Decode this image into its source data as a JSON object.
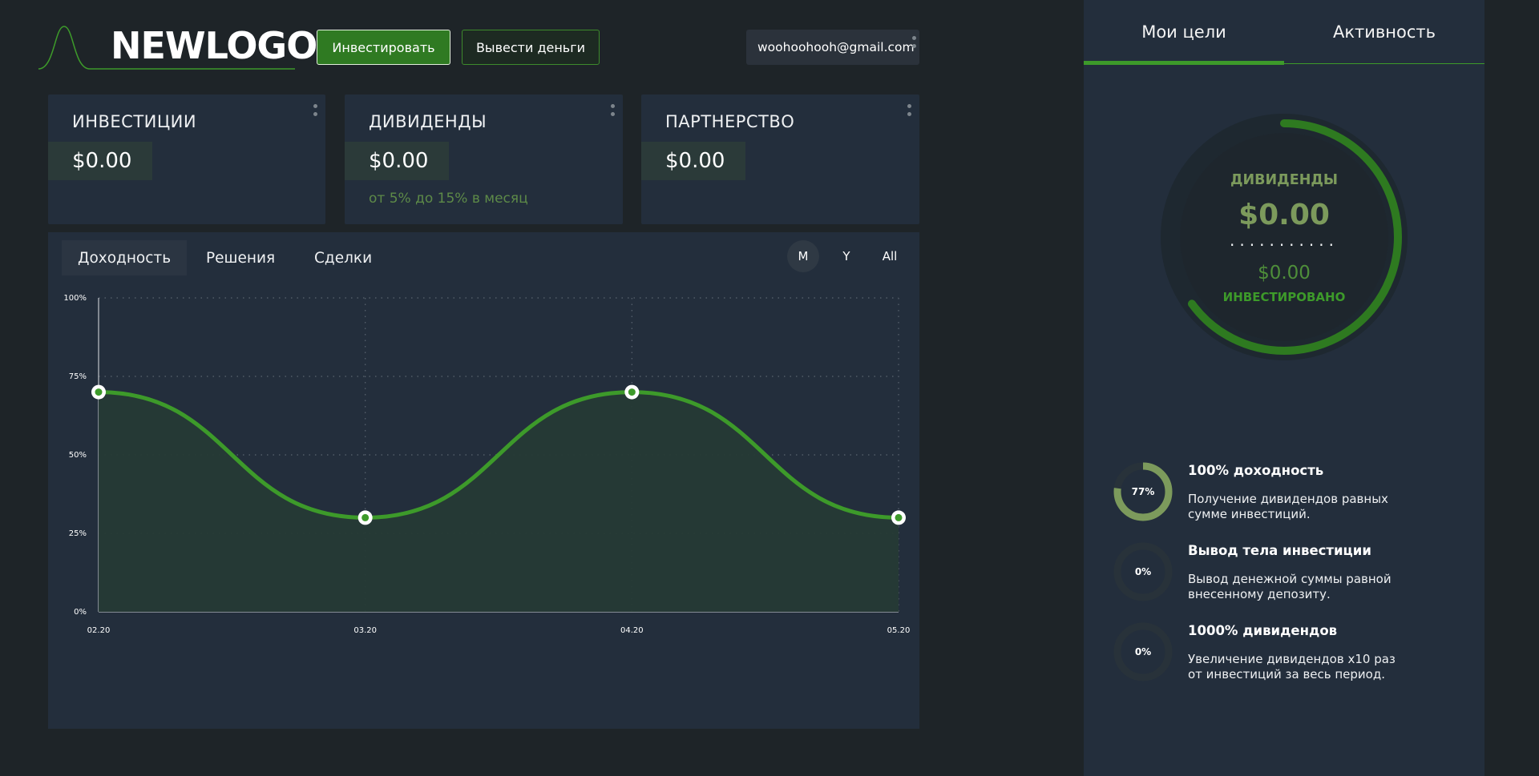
{
  "header": {
    "logo_text": "NEWLOGO",
    "invest_button": "Инвестировать",
    "withdraw_button": "Вывести деньги",
    "user_email": "woohoohooh@gmail.com"
  },
  "cards": [
    {
      "title": "ИНВЕСТИЦИИ",
      "value": "$0.00",
      "subtitle": ""
    },
    {
      "title": "ДИВИДЕНДЫ",
      "value": "$0.00",
      "subtitle": "от 5% до 15% в месяц"
    },
    {
      "title": "ПАРТНЕРСТВО",
      "value": "$0.00",
      "subtitle": ""
    }
  ],
  "chart_tabs": [
    "Доходность",
    "Решения",
    "Сделки"
  ],
  "range_buttons": [
    "M",
    "Y",
    "All"
  ],
  "chart_data": {
    "type": "area",
    "x": [
      "02.20",
      "03.20",
      "04.20",
      "05.20"
    ],
    "y_ticks": [
      "0%",
      "25%",
      "50%",
      "75%",
      "100%"
    ],
    "ylim": [
      0,
      100
    ],
    "series": [
      {
        "values": [
          70,
          30,
          70,
          30
        ]
      }
    ],
    "grid": true
  },
  "right_panel": {
    "tabs": [
      "Мои цели",
      "Активность"
    ],
    "ring_label": "ДИВИДЕНДЫ",
    "ring_value": "$0.00",
    "ring_dots": "...........",
    "ring_invested_value": "$0.00",
    "ring_invested_label": "ИНВЕСТИРОВАНО",
    "ring_progress": 0.65,
    "goals": [
      {
        "title": "100% доходность",
        "desc": "Получение дивидендов равных сумме инвестиций.",
        "pct_label": "77%",
        "pct": 77
      },
      {
        "title": "Вывод тела инвестиции",
        "desc": "Вывод денежной суммы равной внесенному депозиту.",
        "pct_label": "0%",
        "pct": 0
      },
      {
        "title": "1000% дивидендов",
        "desc": "Увеличение дивидендов x10 раз от инвестиций за весь период.",
        "pct_label": "0%",
        "pct": 0
      }
    ]
  },
  "colors": {
    "accent_green": "#3d9a2a",
    "muted_green": "#7c9a5c",
    "panel": "#232e3c",
    "background": "#1e2428"
  }
}
